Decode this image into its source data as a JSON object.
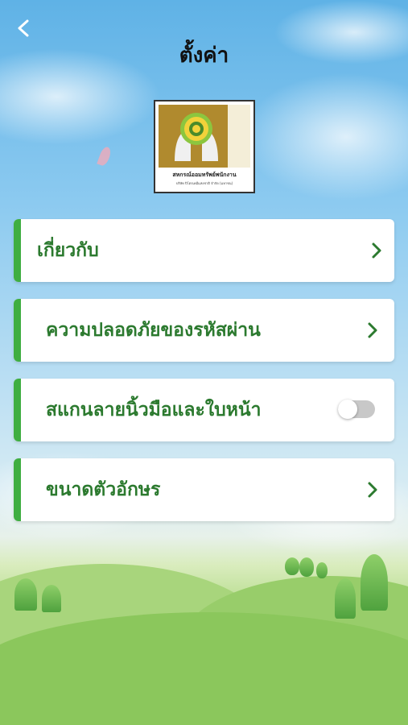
{
  "header": {
    "title": "ตั้งค่า",
    "back_icon": "chevron-left-icon"
  },
  "logo": {
    "org_name": "สหกรณ์ออมทรัพย์พนักงาน",
    "org_sub": "บริษัท ปิโตรเคมีแห่งชาติ จำกัด (มหาชน)"
  },
  "menu": {
    "items": [
      {
        "label": "เกี่ยวกับ",
        "control": "chevron-right-icon"
      },
      {
        "label": "ความปลอดภัยของรหัสผ่าน",
        "control": "chevron-right-icon"
      },
      {
        "label": "สแกนลายนิ้วมือและใบหน้า",
        "control": "toggle-switch",
        "toggle_on": false
      },
      {
        "label": "ขนาดตัวอักษร",
        "control": "chevron-right-icon"
      }
    ]
  },
  "colors": {
    "accent": "#3fae41",
    "label": "#2c7a2f",
    "sky": "#8ccaf0"
  }
}
